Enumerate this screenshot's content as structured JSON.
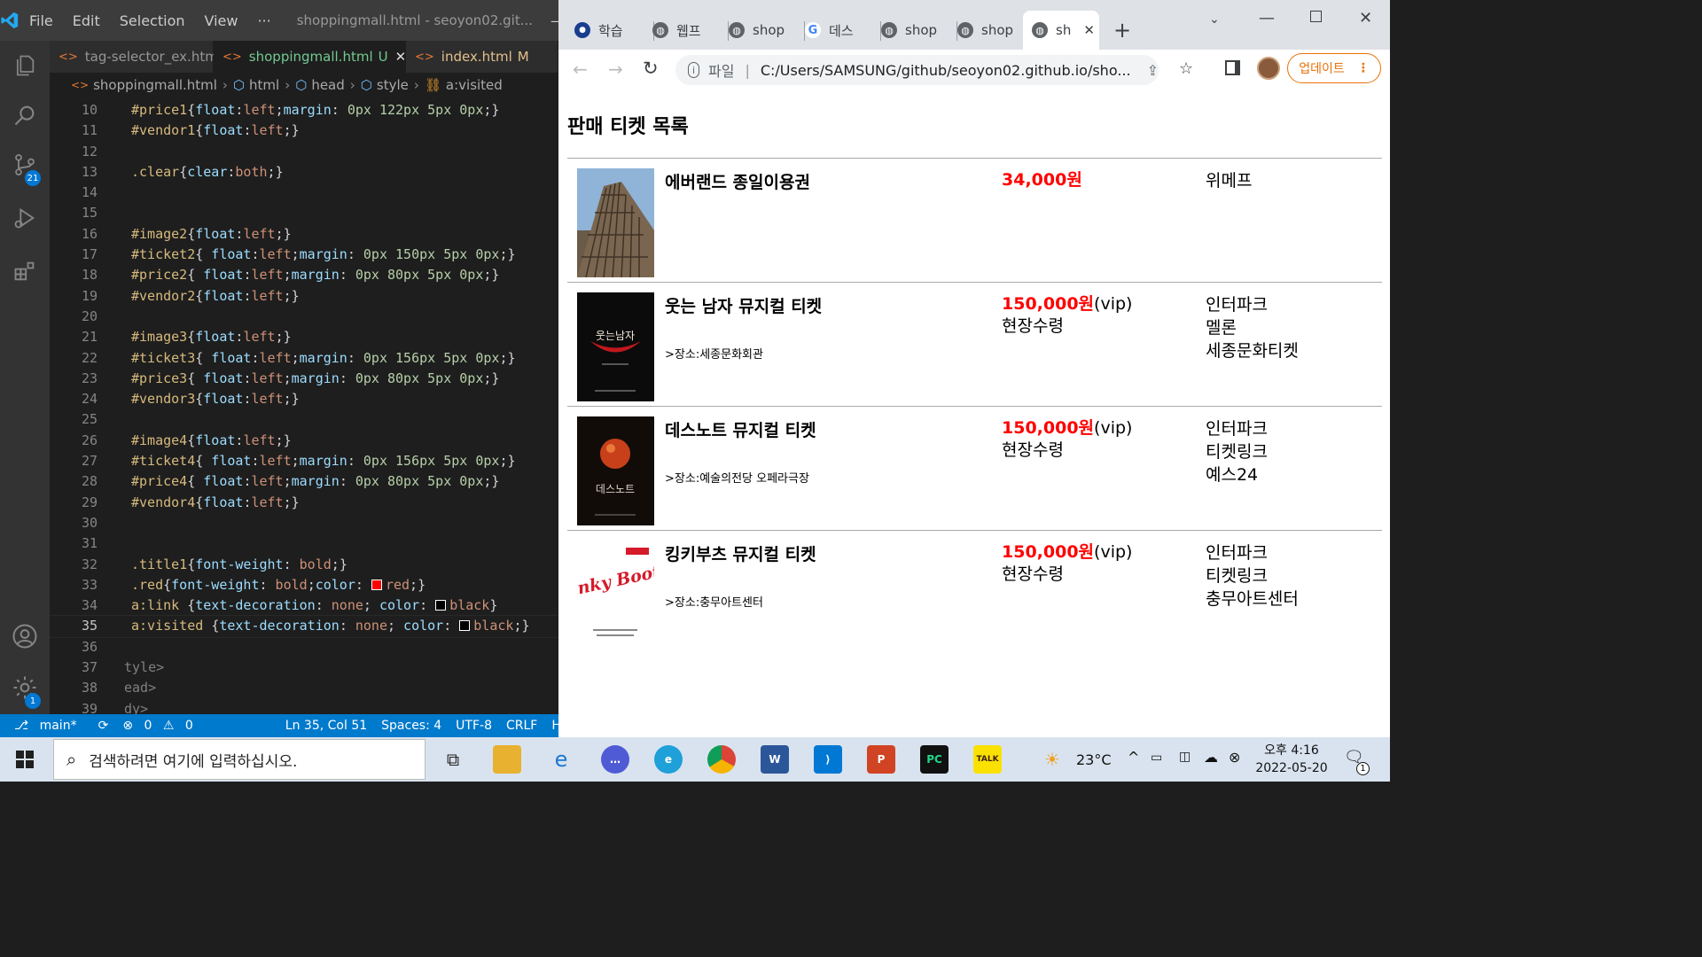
{
  "vscode": {
    "menu": [
      "File",
      "Edit",
      "Selection",
      "View",
      "···"
    ],
    "window_title": "shoppingmall.html - seoyon02.git...",
    "tabs": [
      {
        "label": "tag-selector_ex.html",
        "status": ""
      },
      {
        "label": "shoppingmall.html",
        "status": "U"
      },
      {
        "label": "index.html",
        "status": "M"
      }
    ],
    "breadcrumb": [
      "shoppingmall.html",
      "html",
      "head",
      "style",
      "a:visited"
    ],
    "lines": [
      {
        "n": "10",
        "code": "#price1{float:left;margin: 0px 122px 5px 0px;}"
      },
      {
        "n": "11",
        "code": "#vendor1{float:left;}"
      },
      {
        "n": "12",
        "code": ""
      },
      {
        "n": "13",
        "code": ".clear{clear:both;}"
      },
      {
        "n": "14",
        "code": ""
      },
      {
        "n": "15",
        "code": ""
      },
      {
        "n": "16",
        "code": "#image2{float:left;}"
      },
      {
        "n": "17",
        "code": "#ticket2{ float:left;margin: 0px 150px 5px 0px;}"
      },
      {
        "n": "18",
        "code": "#price2{ float:left;margin: 0px 80px 5px 0px;}"
      },
      {
        "n": "19",
        "code": "#vendor2{float:left;}"
      },
      {
        "n": "20",
        "code": ""
      },
      {
        "n": "21",
        "code": "#image3{float:left;}"
      },
      {
        "n": "22",
        "code": "#ticket3{ float:left;margin: 0px 156px 5px 0px;}"
      },
      {
        "n": "23",
        "code": "#price3{ float:left;margin: 0px 80px 5px 0px;}"
      },
      {
        "n": "24",
        "code": "#vendor3{float:left;}"
      },
      {
        "n": "25",
        "code": ""
      },
      {
        "n": "26",
        "code": "#image4{float:left;}"
      },
      {
        "n": "27",
        "code": "#ticket4{ float:left;margin: 0px 156px 5px 0px;}"
      },
      {
        "n": "28",
        "code": "#price4{ float:left;margin: 0px 80px 5px 0px;}"
      },
      {
        "n": "29",
        "code": "#vendor4{float:left;}"
      },
      {
        "n": "30",
        "code": ""
      },
      {
        "n": "31",
        "code": ""
      },
      {
        "n": "32",
        "code": ".title1{font-weight: bold;}"
      },
      {
        "n": "33",
        "code": ".red{font-weight: bold;color: red;}"
      },
      {
        "n": "34",
        "code": "a:link {text-decoration: none; color: black}"
      },
      {
        "n": "35",
        "code": "a:visited {text-decoration: none; color: black;}"
      },
      {
        "n": "36",
        "code": ""
      },
      {
        "n": "37",
        "code": "tyle>"
      },
      {
        "n": "38",
        "code": "ead>"
      },
      {
        "n": "39",
        "code": "dy>"
      }
    ],
    "activity_badges": {
      "scm": "21",
      "settings": "1"
    },
    "status": {
      "branch": "main*",
      "errors": "0",
      "warnings": "0",
      "position": "Ln 35, Col 51",
      "spaces": "Spaces: 4",
      "encoding": "UTF-8",
      "eol": "CRLF",
      "language": "HTML"
    }
  },
  "chrome": {
    "tabs": [
      "학습",
      "웹프",
      "shop",
      "데스",
      "shop",
      "shop",
      "sh"
    ],
    "address_prefix": "파일",
    "address": "C:/Users/SAMSUNG/github/seoyon02.github.io/sho...",
    "update_label": "업데이트"
  },
  "page": {
    "title": "판매 티켓 목록",
    "items": [
      {
        "name": "에버랜드 종일이용권",
        "place": "",
        "price": "34,000원",
        "price_suffix": "",
        "price_note": "",
        "vendors": [
          "위메프"
        ]
      },
      {
        "name": "웃는 남자 뮤지컬 티켓",
        "place": ">장소:세종문화회관",
        "price": "150,000원",
        "price_suffix": "(vip)",
        "price_note": "현장수령",
        "vendors": [
          "인터파크",
          "멜론",
          "세종문화티켓"
        ]
      },
      {
        "name": "데스노트 뮤지컬 티켓",
        "place": ">장소:예술의전당 오페라극장",
        "price": "150,000원",
        "price_suffix": "(vip)",
        "price_note": "현장수령",
        "vendors": [
          "인터파크",
          "티켓링크",
          "예스24"
        ]
      },
      {
        "name": "킹키부츠 뮤지컬 티켓",
        "place": ">장소:충무아트센터",
        "price": "150,000원",
        "price_suffix": "(vip)",
        "price_note": "현장수령",
        "vendors": [
          "인터파크",
          "티켓링크",
          "충무아트센터"
        ]
      }
    ],
    "poster_text": {
      "item2": "웃는남자",
      "item3": "데스노트",
      "item4": "Kinky Boots"
    }
  },
  "taskbar": {
    "search_placeholder": "검색하려면 여기에 입력하십시오.",
    "weather": "23°C",
    "time": "오후 4:16",
    "date": "2022-05-20",
    "notification_count": "1"
  },
  "colors": {
    "accent": "#007acc",
    "price_red": "#ff0000",
    "update_orange": "#e8710a"
  }
}
